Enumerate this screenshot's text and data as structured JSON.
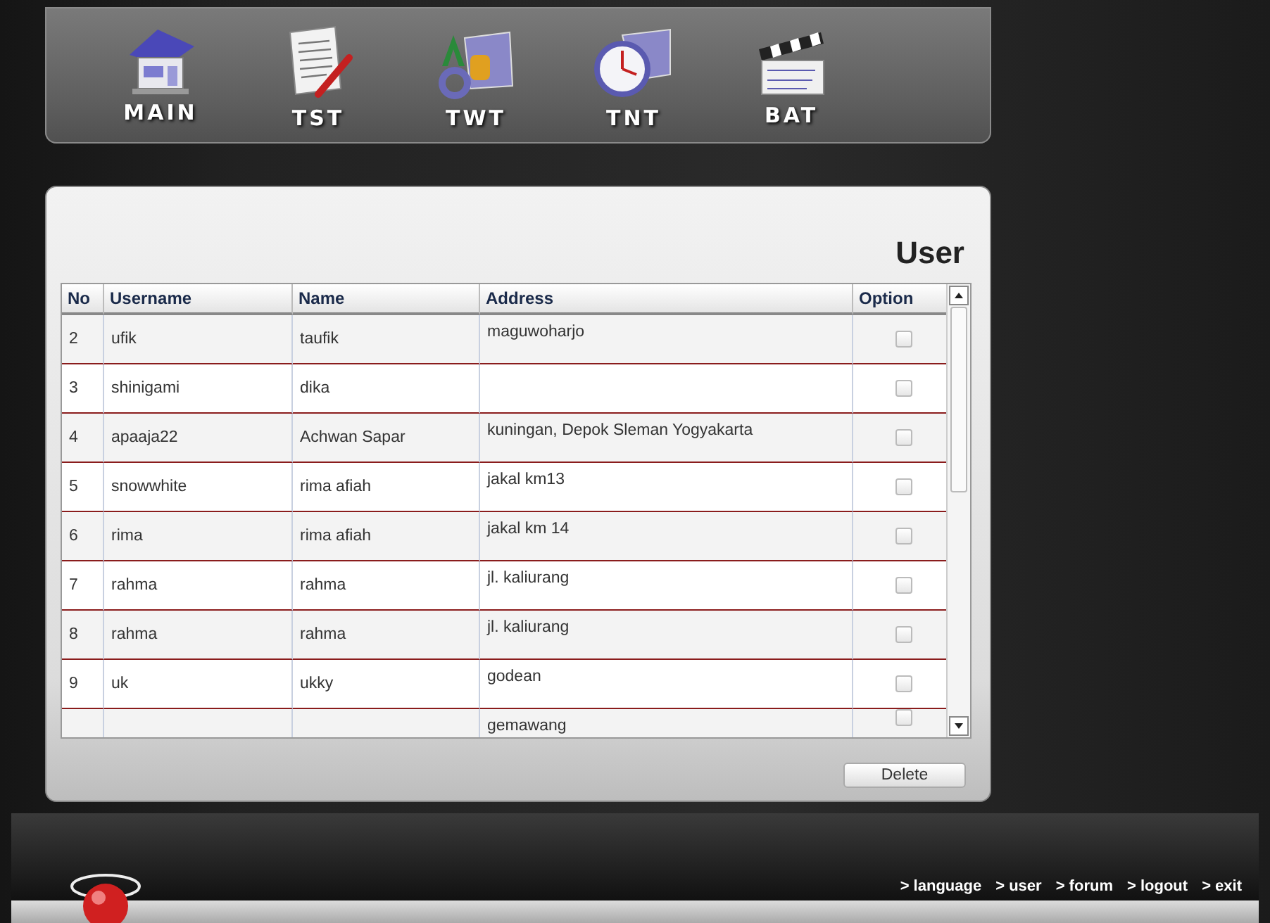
{
  "nav": [
    {
      "kind": "house",
      "label": "MAIN"
    },
    {
      "kind": "document",
      "label": "TST"
    },
    {
      "kind": "letters",
      "label": "TWT"
    },
    {
      "kind": "clock",
      "label": "TNT"
    },
    {
      "kind": "clapper",
      "label": "BAT"
    }
  ],
  "panel": {
    "title": "User"
  },
  "table": {
    "columns": [
      "No",
      "Username",
      "Name",
      "Address",
      "Option"
    ],
    "rows": [
      {
        "no": "2",
        "username": "ufik",
        "name": "taufik",
        "address": "maguwoharjo",
        "checked": false
      },
      {
        "no": "3",
        "username": "shinigami",
        "name": "dika",
        "address": "",
        "checked": false
      },
      {
        "no": "4",
        "username": "apaaja22",
        "name": "Achwan Sapar",
        "address": "kuningan, Depok Sleman Yogyakarta",
        "checked": false
      },
      {
        "no": "5",
        "username": "snowwhite",
        "name": "rima afiah",
        "address": "jakal km13",
        "checked": false
      },
      {
        "no": "6",
        "username": "rima",
        "name": "rima afiah",
        "address": "jakal km 14",
        "checked": false
      },
      {
        "no": "7",
        "username": "rahma",
        "name": "rahma",
        "address": "jl. kaliurang",
        "checked": false
      },
      {
        "no": "8",
        "username": "rahma",
        "name": "rahma",
        "address": "jl. kaliurang",
        "checked": false
      },
      {
        "no": "9",
        "username": "uk",
        "name": "ukky",
        "address": "godean",
        "checked": false
      },
      {
        "no": "",
        "username": "",
        "name": "",
        "address": "gemawang",
        "checked": false
      }
    ]
  },
  "delete_button": "Delete",
  "footer_links": [
    "> language",
    "> user",
    "> forum",
    "> logout",
    "> exit"
  ]
}
